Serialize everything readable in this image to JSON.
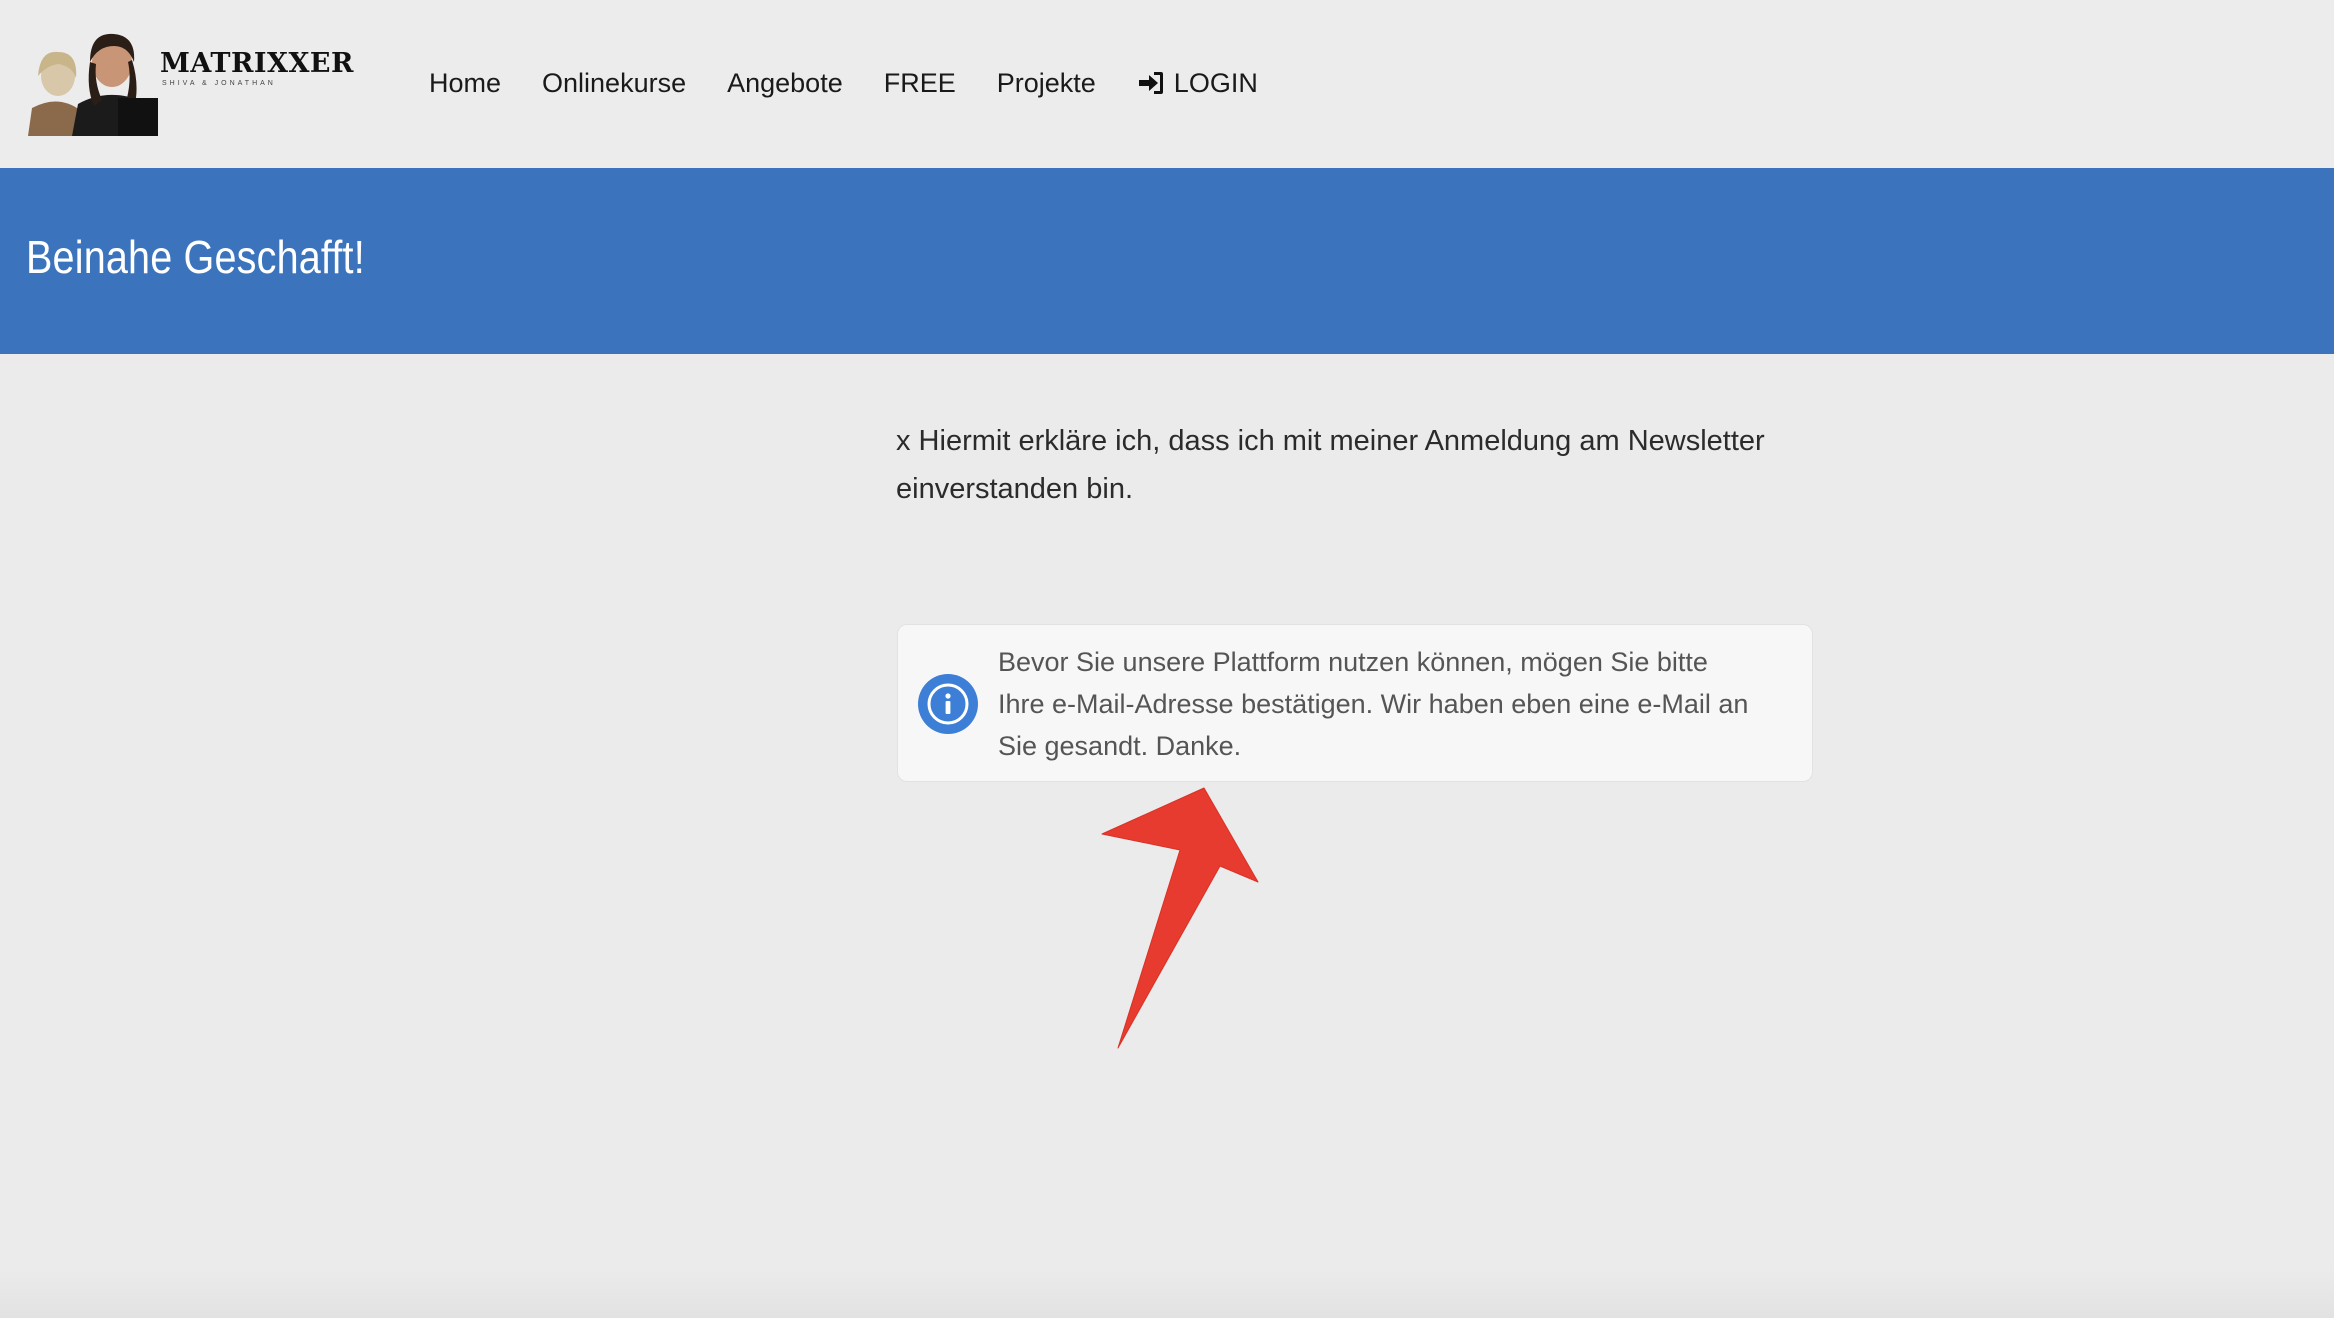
{
  "brand": {
    "name": "MATRIXXER",
    "tagline": "SHIVA & JONATHAN"
  },
  "nav": {
    "items": [
      {
        "label": "Home"
      },
      {
        "label": "Onlinekurse"
      },
      {
        "label": "Angebote"
      },
      {
        "label": "FREE"
      },
      {
        "label": "Projekte"
      }
    ],
    "login_label": "LOGIN",
    "login_icon": "sign-in-icon"
  },
  "page": {
    "title": "Beinahe Geschafft!",
    "consent_text": "x Hiermit erkläre ich, dass ich mit meiner Anmeldung am Newsletter einverstanden bin.",
    "notice_text": "Bevor Sie unsere Plattform nutzen können, mögen Sie bitte Ihre e-Mail-Adresse bestätigen. Wir haben eben eine e-Mail an Sie gesandt. Danke.",
    "notice_icon": "info-icon"
  },
  "colors": {
    "header_bg": "#ececec",
    "title_band": "#3b74bc",
    "page_bg": "#ebebeb",
    "info_icon": "#3d7fd6",
    "arrow": "#e63b2e"
  }
}
